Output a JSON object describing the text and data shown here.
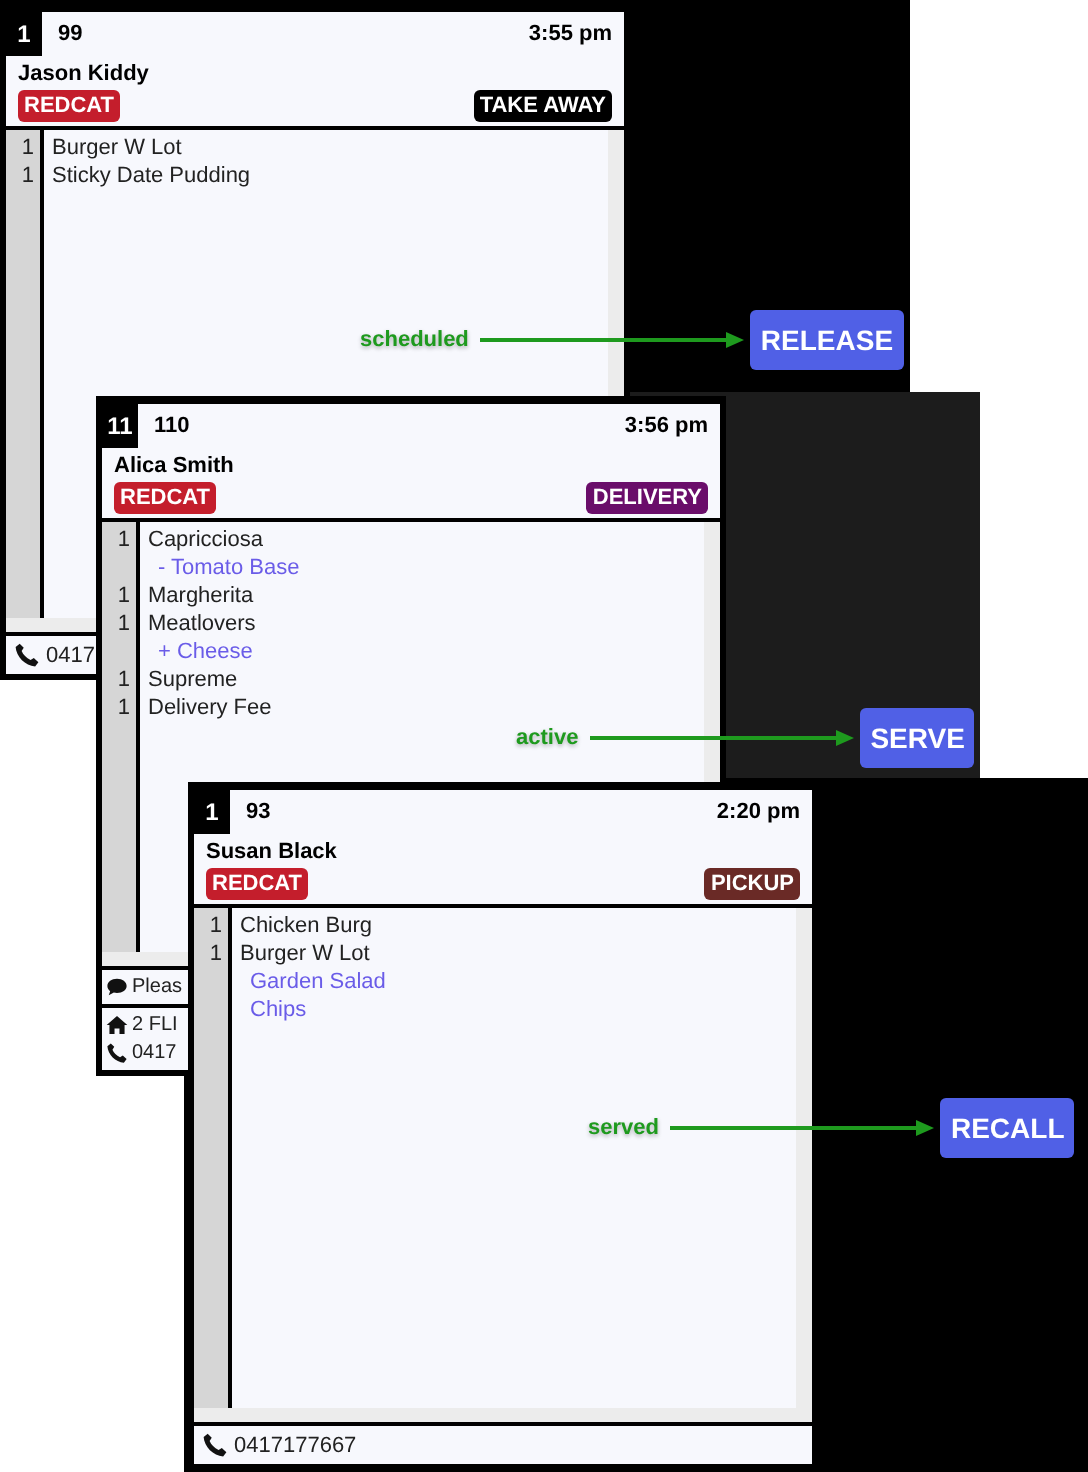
{
  "orders": [
    {
      "seat": "1",
      "number": "99",
      "time": "3:55 pm",
      "customer": "Jason Kiddy",
      "source": "REDCAT",
      "order_type": {
        "label": "TAKE AWAY",
        "kind": "takeaway"
      },
      "items": [
        {
          "qty": "1",
          "name": "Burger W Lot"
        },
        {
          "qty": "1",
          "name": "Sticky Date Pudding"
        }
      ],
      "footer": [
        {
          "kind": "phone",
          "text": "0417"
        }
      ],
      "annotation": {
        "label": "scheduled",
        "button": "RELEASE"
      }
    },
    {
      "seat": "11",
      "number": "110",
      "time": "3:56 pm",
      "customer": "Alica Smith",
      "source": "REDCAT",
      "order_type": {
        "label": "DELIVERY",
        "kind": "delivery"
      },
      "items": [
        {
          "qty": "1",
          "name": "Capricciosa",
          "modifiers": [
            "- Tomato Base"
          ]
        },
        {
          "qty": "1",
          "name": "Margherita"
        },
        {
          "qty": "1",
          "name": "Meatlovers",
          "modifiers": [
            "+ Cheese"
          ]
        },
        {
          "qty": "1",
          "name": "Supreme"
        },
        {
          "qty": "1",
          "name": "Delivery Fee"
        }
      ],
      "footer": [
        {
          "kind": "note",
          "text": "Pleas"
        },
        {
          "kind": "address",
          "text": "2 FLI"
        },
        {
          "kind": "phone",
          "text": "0417"
        }
      ],
      "annotation": {
        "label": "active",
        "button": "SERVE"
      }
    },
    {
      "seat": "1",
      "number": "93",
      "time": "2:20 pm",
      "customer": "Susan Black",
      "source": "REDCAT",
      "order_type": {
        "label": "PICKUP",
        "kind": "pickup"
      },
      "items": [
        {
          "qty": "1",
          "name": "Chicken Burg"
        },
        {
          "qty": "1",
          "name": "Burger W Lot",
          "modifiers": [
            "Garden Salad",
            "Chips"
          ]
        }
      ],
      "footer": [
        {
          "kind": "phone",
          "text": "0417177667"
        }
      ],
      "annotation": {
        "label": "served",
        "button": "RECALL"
      }
    }
  ]
}
